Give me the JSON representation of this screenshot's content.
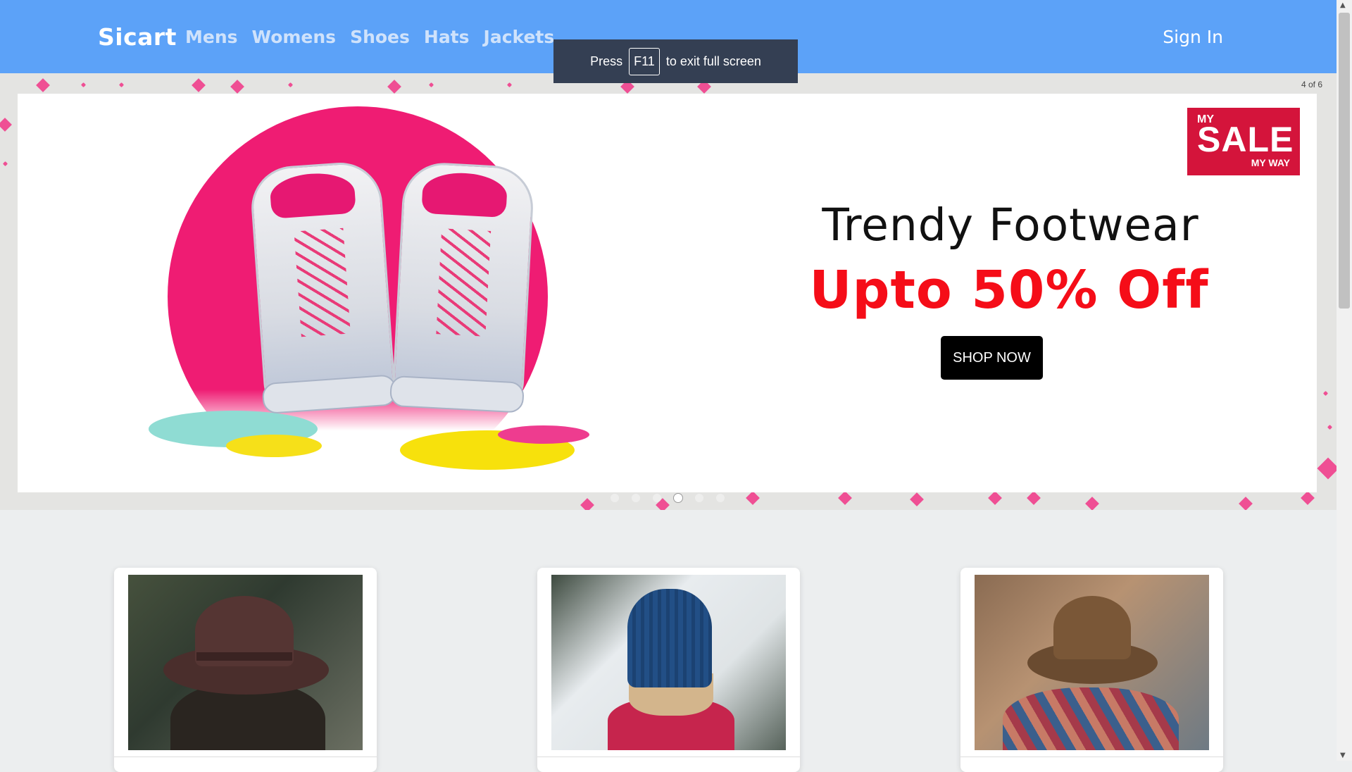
{
  "navbar": {
    "brand": "Sicart",
    "links": [
      "Mens",
      "Womens",
      "Shoes",
      "Hats",
      "Jackets"
    ],
    "signin": "Sign In"
  },
  "fullscreen_notice": {
    "press": "Press",
    "key": "F11",
    "suffix": "to exit full screen"
  },
  "carousel": {
    "counter": "4 of 6",
    "slide": {
      "badge_top": "MY",
      "badge_main": "SALE",
      "badge_bottom": "MY WAY",
      "title": "Trendy Footwear",
      "subtitle": "Upto 50% Off",
      "button": "SHOP NOW"
    },
    "indicator_count": 6,
    "active_index": 3
  },
  "cards": [
    {
      "image": "brown fedora hat photo"
    },
    {
      "image": "blue beanie hat photo"
    },
    {
      "image": "brown cowboy hat photo"
    }
  ],
  "colors": {
    "navbar": "#5ca2f8",
    "accent_pink": "#ef1c73",
    "sale_red": "#f50d18",
    "page_bg": "#eceeef"
  }
}
